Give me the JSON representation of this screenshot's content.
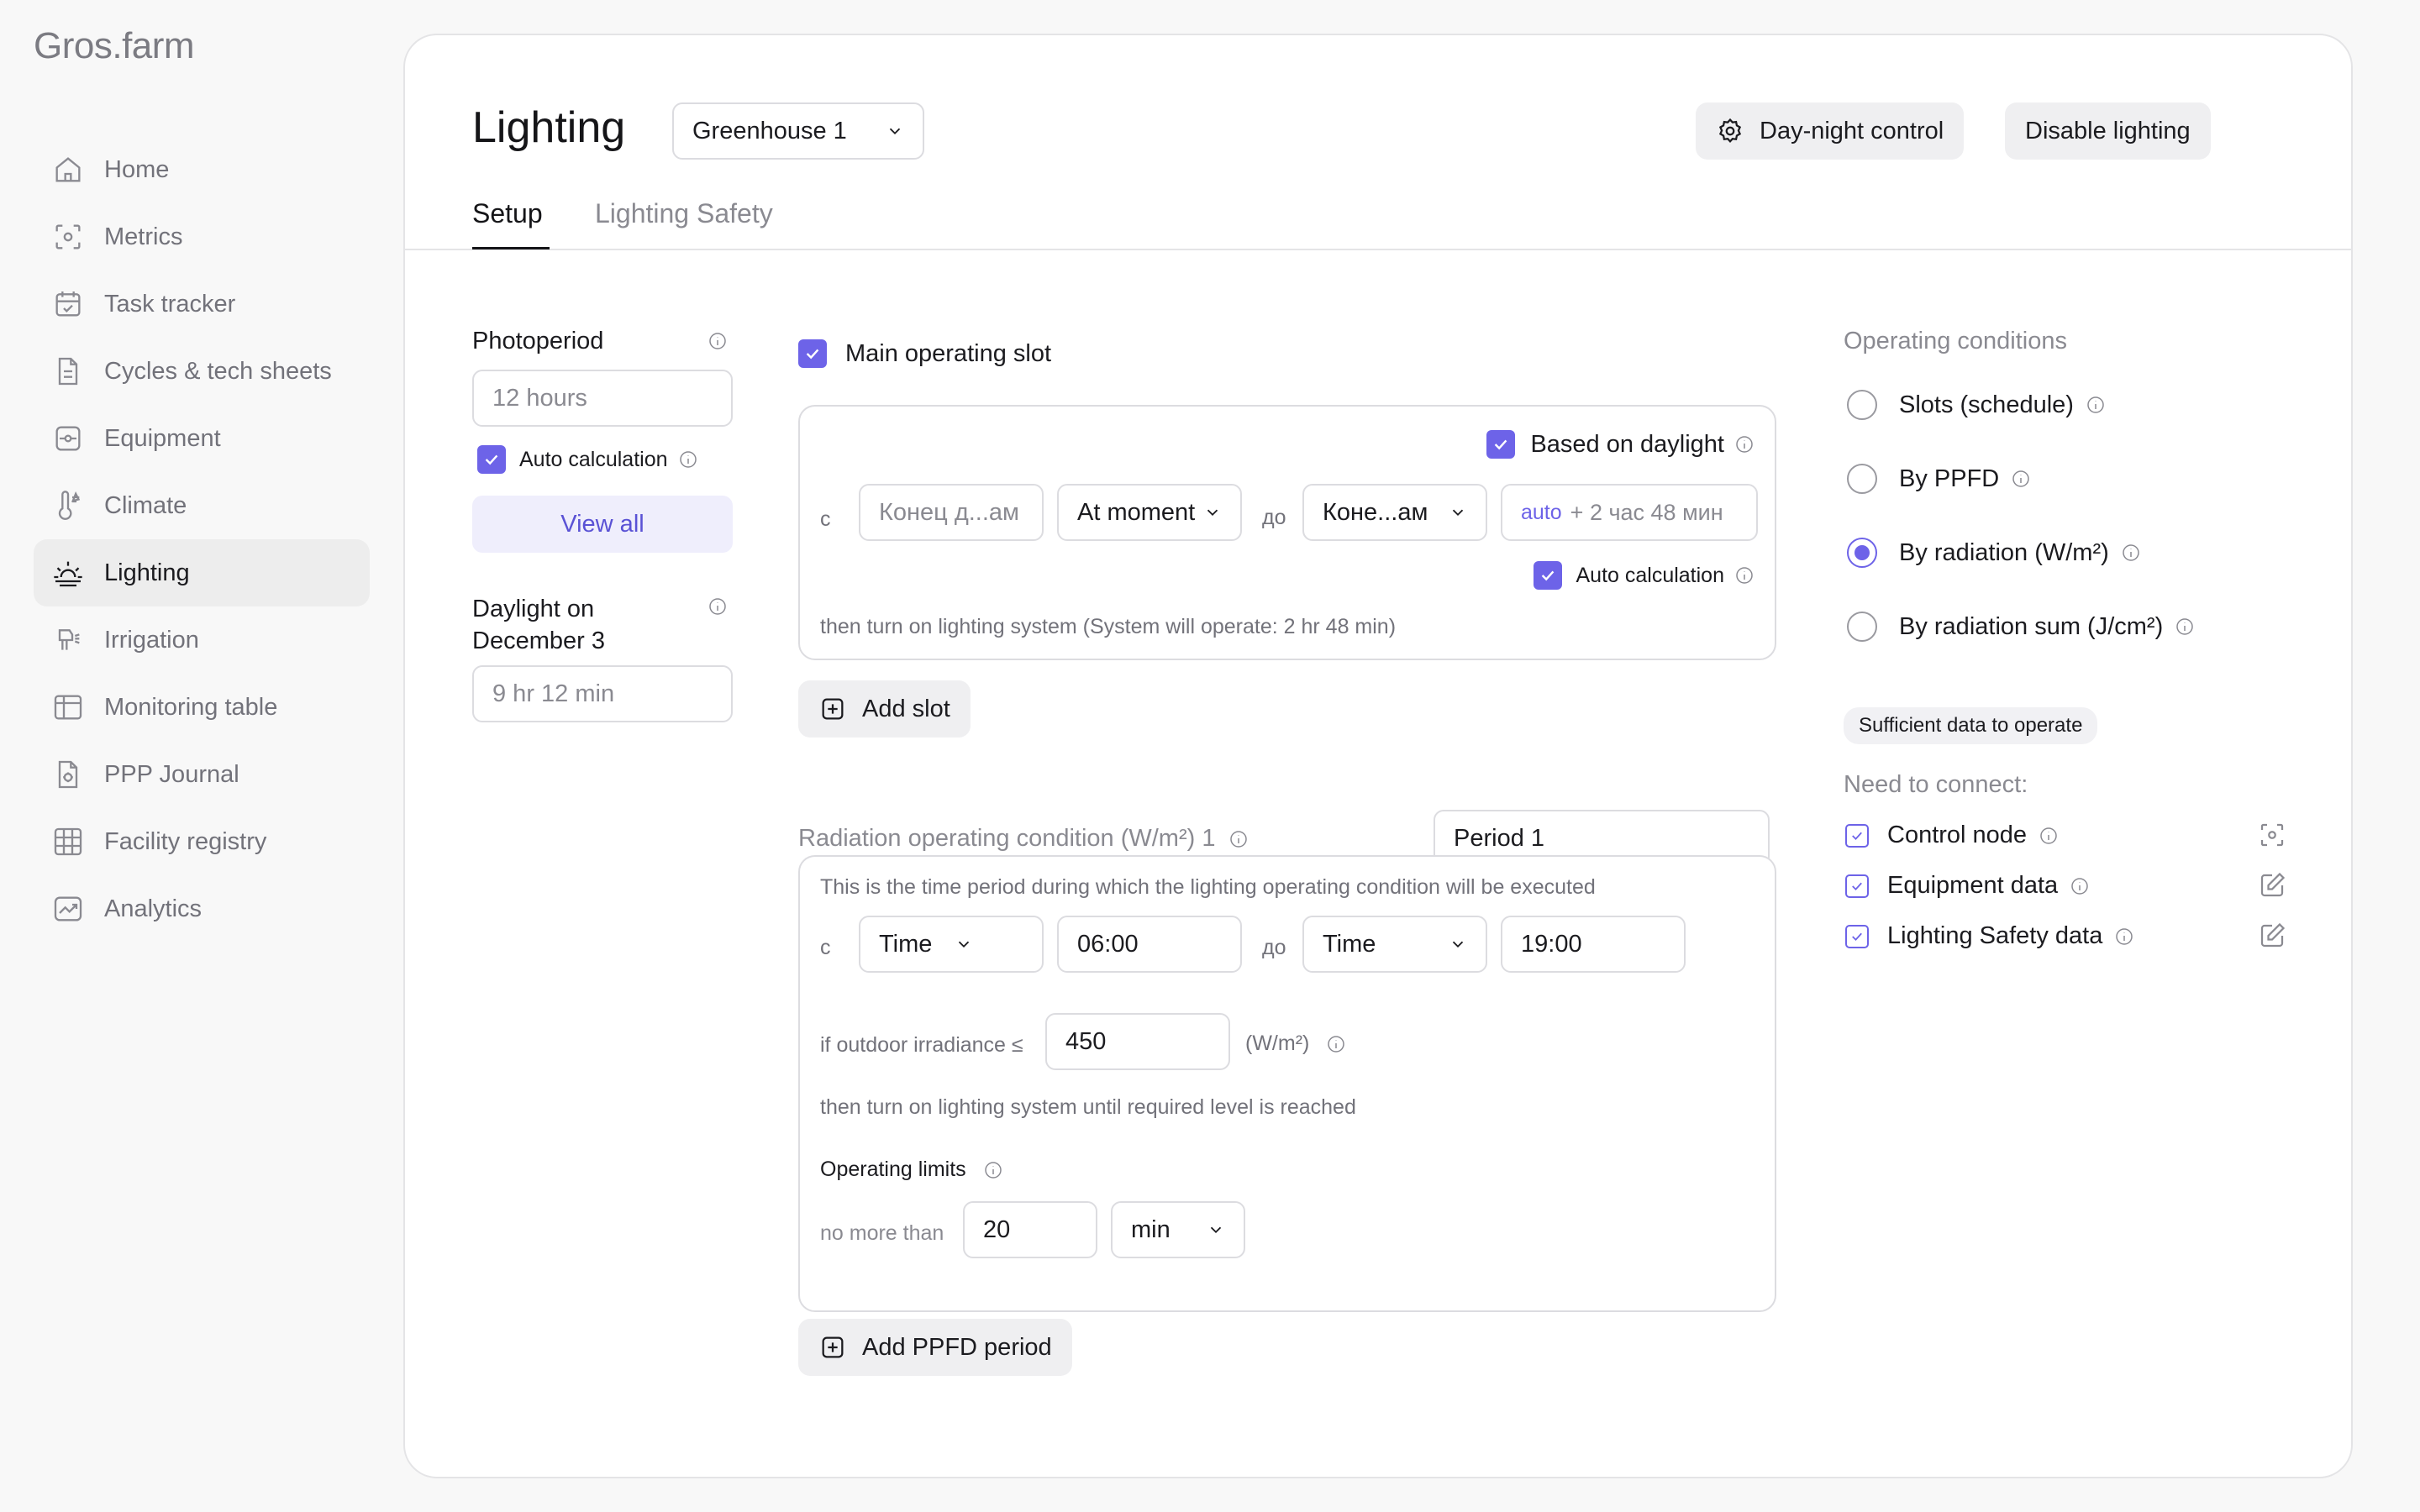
{
  "app": {
    "logo": "Gros.farm"
  },
  "sidebar": {
    "items": [
      {
        "label": "Home",
        "icon": "home-icon"
      },
      {
        "label": "Metrics",
        "icon": "metrics-icon"
      },
      {
        "label": "Task tracker",
        "icon": "calendar-icon"
      },
      {
        "label": "Cycles & tech sheets",
        "icon": "document-icon"
      },
      {
        "label": "Equipment",
        "icon": "equipment-icon"
      },
      {
        "label": "Climate",
        "icon": "thermometer-icon"
      },
      {
        "label": "Lighting",
        "icon": "sunrise-icon",
        "active": true
      },
      {
        "label": "Irrigation",
        "icon": "sprinkler-icon"
      },
      {
        "label": "Monitoring table",
        "icon": "table-icon"
      },
      {
        "label": "PPP Journal",
        "icon": "journal-icon"
      },
      {
        "label": "Facility registry",
        "icon": "grid-icon"
      },
      {
        "label": "Analytics",
        "icon": "chart-icon"
      }
    ]
  },
  "header": {
    "title": "Lighting",
    "greenhouse_select": "Greenhouse 1",
    "day_night_button": "Day-night control",
    "disable_button": "Disable lighting",
    "tabs": [
      {
        "label": "Setup",
        "active": true
      },
      {
        "label": "Lighting Safety",
        "active": false
      }
    ]
  },
  "left": {
    "photoperiod_label": "Photoperiod",
    "photoperiod_value": "12 hours",
    "auto_calc_label": "Auto calculation",
    "view_all": "View all",
    "daylight_label_line1": "Daylight on",
    "daylight_label_line2": "December 3",
    "daylight_value": "9 hr 12 min"
  },
  "slot": {
    "main_slot_label": "Main operating slot",
    "based_on_daylight": "Based on daylight",
    "from_prefix": "с",
    "from_value": "Конец д...ам",
    "moment_select": "At moment",
    "to_prefix": "до",
    "to_value": "Коне...ам",
    "auto_word": "auto",
    "auto_extra": "+ 2 час 48 мин",
    "auto_calc_label": "Auto calculation",
    "footer_text": "then turn on lighting system (System will operate: 2 hr 48 min)",
    "add_slot": "Add slot"
  },
  "radiation": {
    "title": "Radiation operating condition (W/m²) 1",
    "period_value": "Period 1",
    "description": "This is the time period during which the lighting operating condition will be executed",
    "from_prefix": "с",
    "from_type": "Time",
    "from_time": "06:00",
    "to_prefix": "до",
    "to_type": "Time",
    "to_time": "19:00",
    "if_label": "if outdoor irradiance ≤",
    "irradiance_value": "450",
    "unit": "(W/m²)",
    "then_text": "then turn on lighting system until required level is reached",
    "limits_label": "Operating limits",
    "no_more_than": "no more than",
    "limit_value": "20",
    "limit_unit": "min",
    "add_period": "Add PPFD period"
  },
  "conditions": {
    "title": "Operating conditions",
    "options": [
      {
        "label": "Slots (schedule)",
        "selected": false
      },
      {
        "label": "By PPFD",
        "selected": false
      },
      {
        "label": "By radiation (W/m²)",
        "selected": true
      },
      {
        "label": "By radiation sum (J/cm²)",
        "selected": false
      }
    ],
    "status_badge": "Sufficient data to operate",
    "need_label": "Need to connect:",
    "requirements": [
      {
        "label": "Control node",
        "action_icon": "scan-icon"
      },
      {
        "label": "Equipment data",
        "action_icon": "edit-icon"
      },
      {
        "label": "Lighting Safety data",
        "action_icon": "edit-icon"
      }
    ]
  },
  "colors": {
    "accent": "#6d63e8",
    "background": "#f8f8f8",
    "card": "#ffffff"
  }
}
